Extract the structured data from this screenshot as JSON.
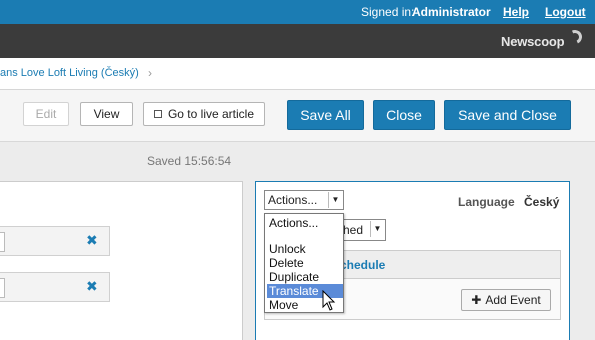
{
  "topbar": {
    "signed_label": "Signed in:",
    "signed_user": "Administrator",
    "help": "Help",
    "logout": "Logout"
  },
  "brand": {
    "logo": "Newscoop"
  },
  "breadcrumb": {
    "text": "ans Love Loft Living (Český)",
    "chevron": "›"
  },
  "toolbar": {
    "edit": "Edit",
    "view": "View",
    "live": "Go to live article",
    "save_all": "Save All",
    "close": "Close",
    "save_close": "Save and Close"
  },
  "saved": "Saved 15:56:54",
  "left_panel": {
    "remove_icon": "✖"
  },
  "right_panel": {
    "actions_value": "Actions...",
    "language_label": "Language",
    "language_value": "Český",
    "status_value": "hed",
    "schedule_title": "chedule",
    "add_event": "Add Event",
    "add_icon": "✚"
  },
  "actions_dropdown": {
    "items": [
      "Actions...",
      "",
      "Unlock",
      "Delete",
      "Duplicate",
      "Translate",
      "Move"
    ],
    "selected": "Translate"
  },
  "colors": {
    "accent": "#1b7cb3",
    "topbar": "#1b7cb3",
    "header": "#3b3b3b",
    "selection": "#5b8bd8"
  }
}
